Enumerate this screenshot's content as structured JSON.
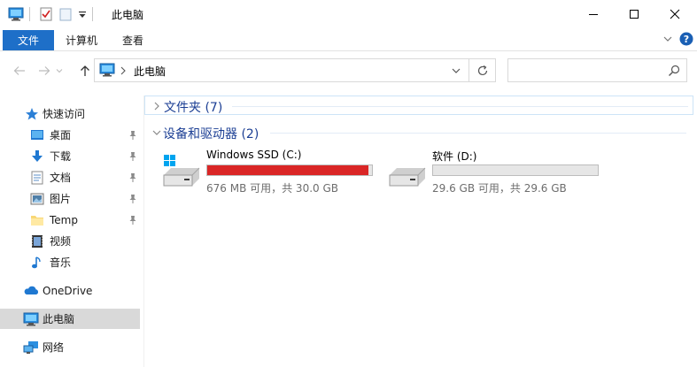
{
  "window": {
    "title": "此电脑"
  },
  "ribbon": {
    "tabs": [
      {
        "label": "文件"
      },
      {
        "label": "计算机"
      },
      {
        "label": "查看"
      }
    ]
  },
  "address": {
    "path": "此电脑"
  },
  "sidebar": {
    "items": [
      {
        "label": "快速访问",
        "icon": "star-icon"
      },
      {
        "label": "桌面",
        "icon": "desktop-icon",
        "pinned": true
      },
      {
        "label": "下载",
        "icon": "download-icon",
        "pinned": true
      },
      {
        "label": "文档",
        "icon": "document-icon",
        "pinned": true
      },
      {
        "label": "图片",
        "icon": "picture-icon",
        "pinned": true
      },
      {
        "label": "Temp",
        "icon": "folder-icon",
        "pinned": true
      },
      {
        "label": "视频",
        "icon": "video-icon"
      },
      {
        "label": "音乐",
        "icon": "music-icon"
      },
      {
        "label": "OneDrive",
        "icon": "cloud-icon"
      },
      {
        "label": "此电脑",
        "icon": "computer-icon",
        "selected": true
      },
      {
        "label": "网络",
        "icon": "network-icon"
      }
    ]
  },
  "content": {
    "groups": [
      {
        "label": "文件夹 (7)",
        "expanded": false
      },
      {
        "label": "设备和驱动器 (2)",
        "expanded": true
      }
    ],
    "drives": [
      {
        "name": "Windows SSD (C:)",
        "size_text": "676 MB 可用，共 30.0 GB",
        "used_fraction": 0.978,
        "bar_color": "#da2626",
        "icon": "windows-drive-icon"
      },
      {
        "name": "软件 (D:)",
        "size_text": "29.6 GB 可用，共 29.6 GB",
        "used_fraction": 0.0,
        "bar_color": "#26a0da",
        "icon": "drive-icon"
      }
    ]
  }
}
